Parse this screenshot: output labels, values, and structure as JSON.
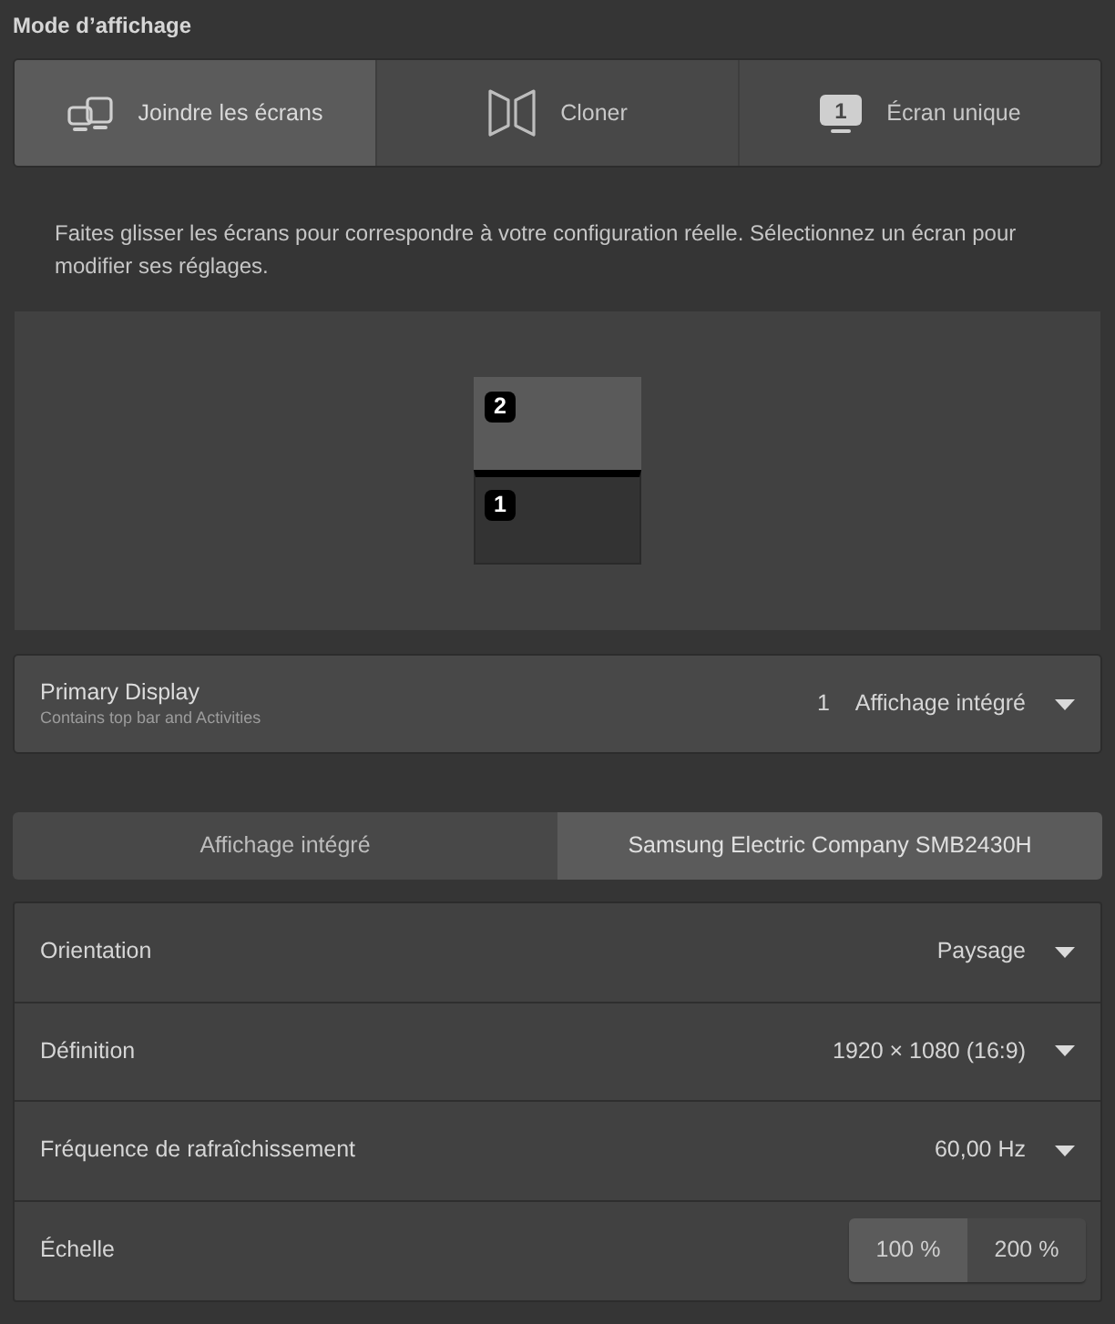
{
  "section_title": "Mode d’affichage",
  "modes": [
    {
      "kind": "join",
      "label": "Joindre les écrans",
      "selected": true
    },
    {
      "kind": "mirror",
      "label": "Cloner",
      "selected": false
    },
    {
      "kind": "single",
      "label": "Écran unique",
      "icon_number": "1",
      "selected": false
    }
  ],
  "description": "Faites glisser les écrans pour correspondre à votre configuration réelle. Sélectionnez un écran pour modifier ses réglages.",
  "monitors": [
    {
      "number": "2",
      "selected": true,
      "primary": false
    },
    {
      "number": "1",
      "selected": false,
      "primary": true
    }
  ],
  "primary_display": {
    "title": "Primary Display",
    "subtitle": "Contains top bar and Activities",
    "number": "1",
    "value": "Affichage intégré"
  },
  "display_tabs": [
    {
      "label": "Affichage intégré",
      "selected": false
    },
    {
      "label": "Samsung Electric Company SMB2430H",
      "selected": true
    }
  ],
  "settings": [
    {
      "kind": "dropdown",
      "label": "Orientation",
      "value": "Paysage"
    },
    {
      "kind": "dropdown",
      "label": "Définition",
      "value": "1920 × 1080 (16:9)"
    },
    {
      "kind": "dropdown",
      "label": "Fréquence de rafraîchissement",
      "value": "60,00 Hz"
    },
    {
      "kind": "choice",
      "label": "Échelle",
      "options": [
        {
          "label": "100 %",
          "selected": true
        },
        {
          "label": "200 %",
          "selected": false
        }
      ]
    }
  ]
}
